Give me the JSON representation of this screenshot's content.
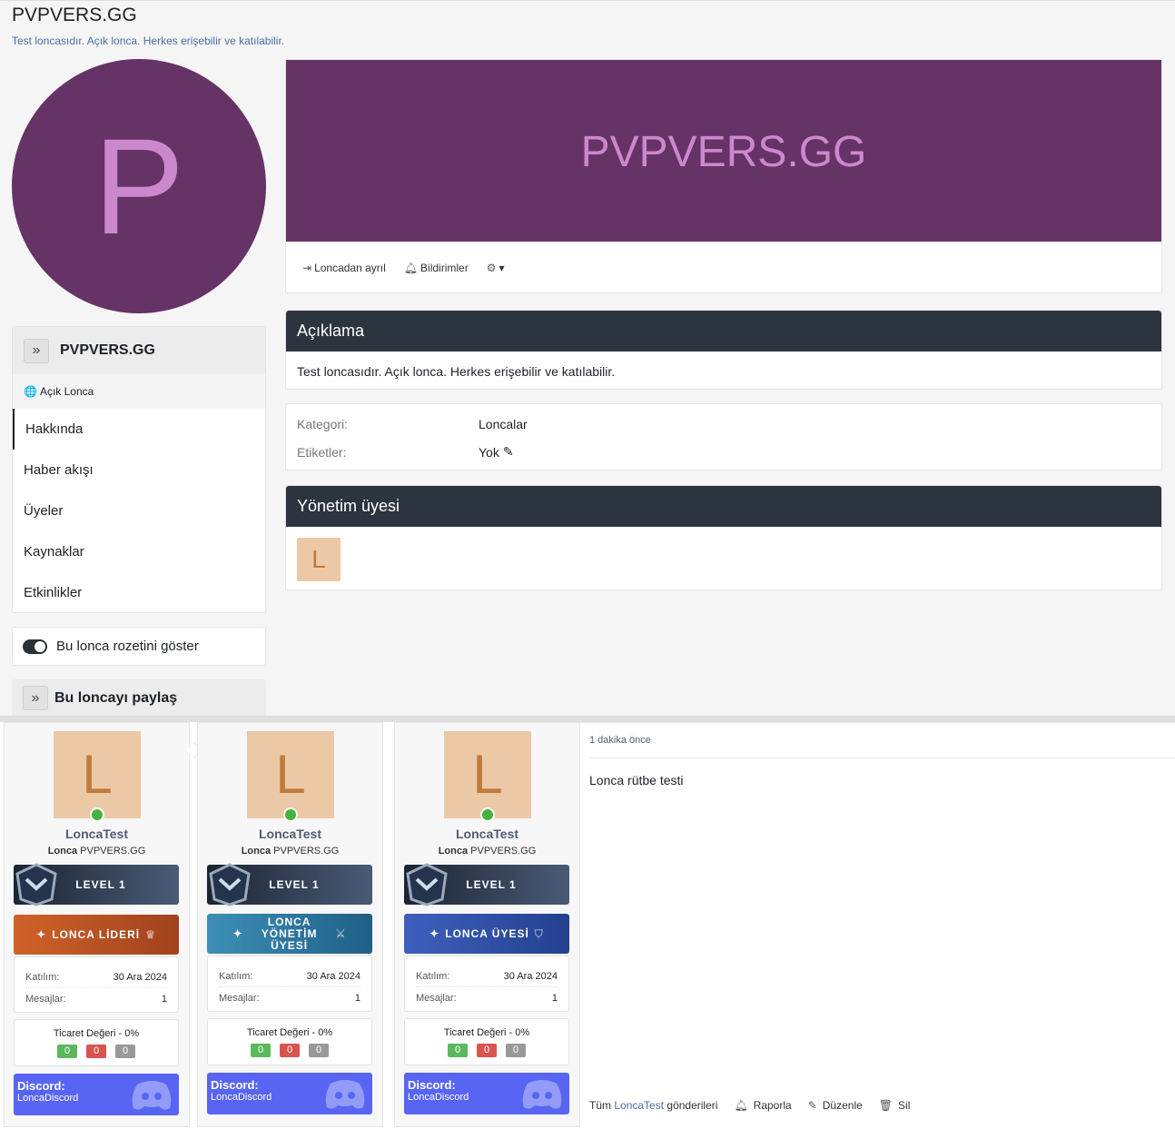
{
  "header": {
    "title": "PVPVERS.GG",
    "subtitle": "Test loncasıdır. Açık lonca. Herkes erişebilir ve katılabilir."
  },
  "guild": {
    "avatar_letter": "P",
    "banner_text": "PVPVERS.GG",
    "color": "#663366"
  },
  "sidebar": {
    "name": "PVPVERS.GG",
    "visibility": "Açık Lonca",
    "items": [
      {
        "label": "Hakkında"
      },
      {
        "label": "Haber akışı"
      },
      {
        "label": "Üyeler"
      },
      {
        "label": "Kaynaklar"
      },
      {
        "label": "Etkinlikler"
      }
    ],
    "toggle_label": "Bu lonca rozetini göster",
    "share_label": "Bu loncayı paylaş"
  },
  "actions": {
    "leave": "Loncadan ayrıl",
    "notifications": "Bildirimler"
  },
  "description": {
    "title": "Açıklama",
    "text": "Test loncasıdır. Açık lonca. Herkes erişebilir ve katılabilir."
  },
  "info": {
    "category_label": "Kategori:",
    "category_value": "Loncalar",
    "tags_label": "Etiketler:",
    "tags_value": "Yok"
  },
  "admins": {
    "title": "Yönetim üyesi",
    "avatar_letter": "L"
  },
  "users": [
    {
      "letter": "L",
      "name": "LoncaTest",
      "sub_bold": "Lonca",
      "sub": "PVPVERS.GG",
      "level": "LEVEL 1",
      "rank": "LONCA LİDERİ",
      "join_label": "Katılım:",
      "join": "30 Ara 2024",
      "msg_label": "Mesajlar:",
      "msg": "1",
      "trade": "Ticaret Değeri - 0%",
      "pos": "0",
      "neg": "0",
      "neu": "0",
      "discord_label": "Discord:",
      "discord": "LoncaDiscord"
    },
    {
      "letter": "L",
      "name": "LoncaTest",
      "sub_bold": "Lonca",
      "sub": "PVPVERS.GG",
      "level": "LEVEL 1",
      "rank": "LONCA YÖNETİM ÜYESİ",
      "join_label": "Katılım:",
      "join": "30 Ara 2024",
      "msg_label": "Mesajlar:",
      "msg": "1",
      "trade": "Ticaret Değeri - 0%",
      "pos": "0",
      "neg": "0",
      "neu": "0",
      "discord_label": "Discord:",
      "discord": "LoncaDiscord"
    },
    {
      "letter": "L",
      "name": "LoncaTest",
      "sub_bold": "Lonca",
      "sub": "PVPVERS.GG",
      "level": "LEVEL 1",
      "rank": "LONCA ÜYESİ",
      "join_label": "Katılım:",
      "join": "30 Ara 2024",
      "msg_label": "Mesajlar:",
      "msg": "1",
      "trade": "Ticaret Değeri - 0%",
      "pos": "0",
      "neg": "0",
      "neu": "0",
      "discord_label": "Discord:",
      "discord": "LoncaDiscord"
    }
  ],
  "post": {
    "time": "1 dakika önce",
    "body": "Lonca rütbe testi",
    "all_prefix": "Tüm",
    "all_user": "LoncaTest",
    "all_suffix": "gönderileri",
    "report": "Raporla",
    "edit": "Düzenle",
    "delete": "Sil"
  },
  "colors": {
    "positive": "#5cb85c",
    "negative": "#d9534f",
    "neutral": "#999999",
    "discord": "#5865f2",
    "header_dark": "#2c3440"
  }
}
